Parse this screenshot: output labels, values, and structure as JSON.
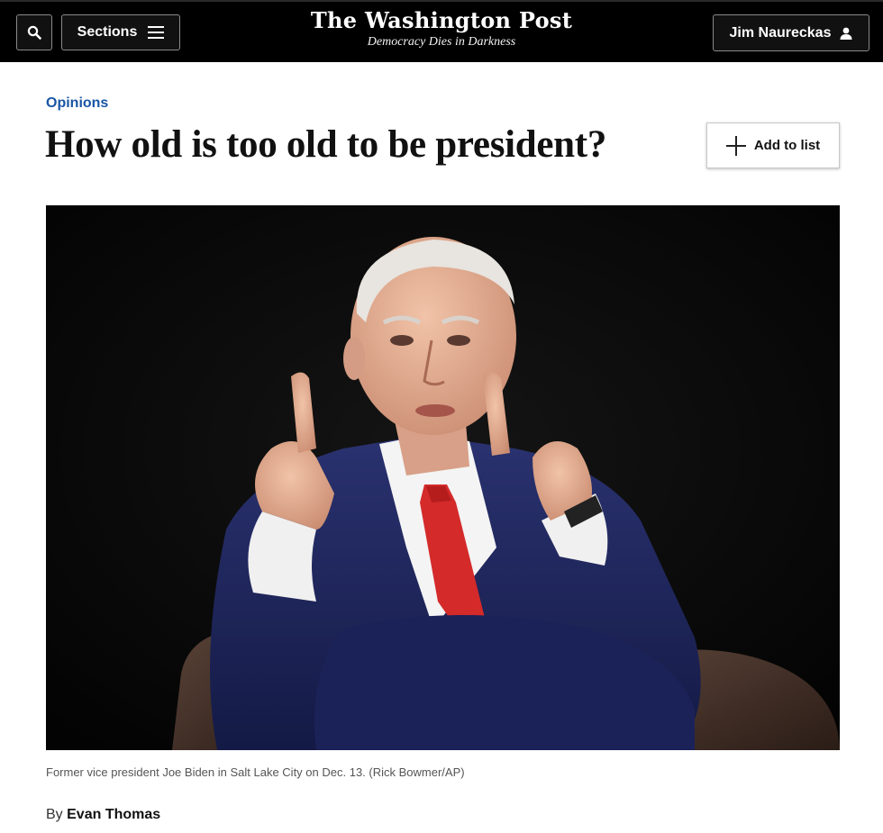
{
  "header": {
    "search_icon": "search-icon",
    "sections_label": "Sections",
    "sections_icon": "hamburger-menu-icon",
    "logo_text": "The Washington Post",
    "tagline": "Democracy Dies in Darkness",
    "user_name": "Jim Naureckas",
    "user_icon": "person-icon",
    "background_color": "#000000"
  },
  "article": {
    "kicker": "Opinions",
    "kicker_color": "#1955a5",
    "headline": "How old is too old to be president?",
    "add_to_list_label": "Add to list",
    "add_to_list_icon": "plus-icon",
    "caption": "Former vice president Joe Biden in Salt Lake City on Dec. 13. (Rick Bowmer/AP)",
    "byline_prefix": "By",
    "author": "Evan Thomas"
  }
}
